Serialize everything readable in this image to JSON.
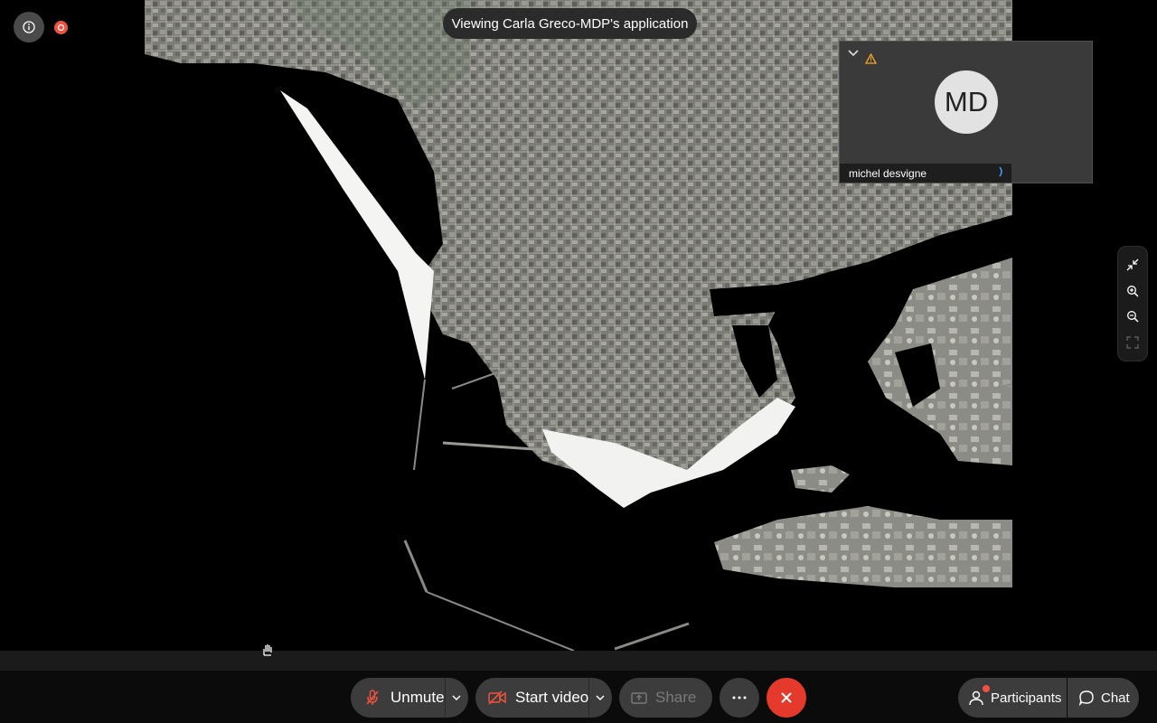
{
  "banner": {
    "text": "Viewing Carla Greco-MDP's application"
  },
  "video_tile": {
    "initials": "MD",
    "name": "michel desvigne"
  },
  "toolbar": {
    "unmute_label": "Unmute",
    "start_video_label": "Start video",
    "share_label": "Share",
    "participants_label": "Participants",
    "chat_label": "Chat"
  },
  "colors": {
    "recording": "#f0523f",
    "leave": "#e5392c",
    "warning": "#f5a623",
    "audio": "#3aa0ff"
  },
  "icons": [
    "info-icon",
    "recording-icon",
    "chevron-down-icon",
    "warning-icon",
    "audio-indicator-icon",
    "exit-fullscreen-icon",
    "zoom-in-icon",
    "zoom-out-icon",
    "fit-screen-icon",
    "raise-hand-icon",
    "mic-muted-icon",
    "video-off-icon",
    "share-icon",
    "more-icon",
    "close-icon",
    "participants-icon",
    "chat-icon"
  ]
}
